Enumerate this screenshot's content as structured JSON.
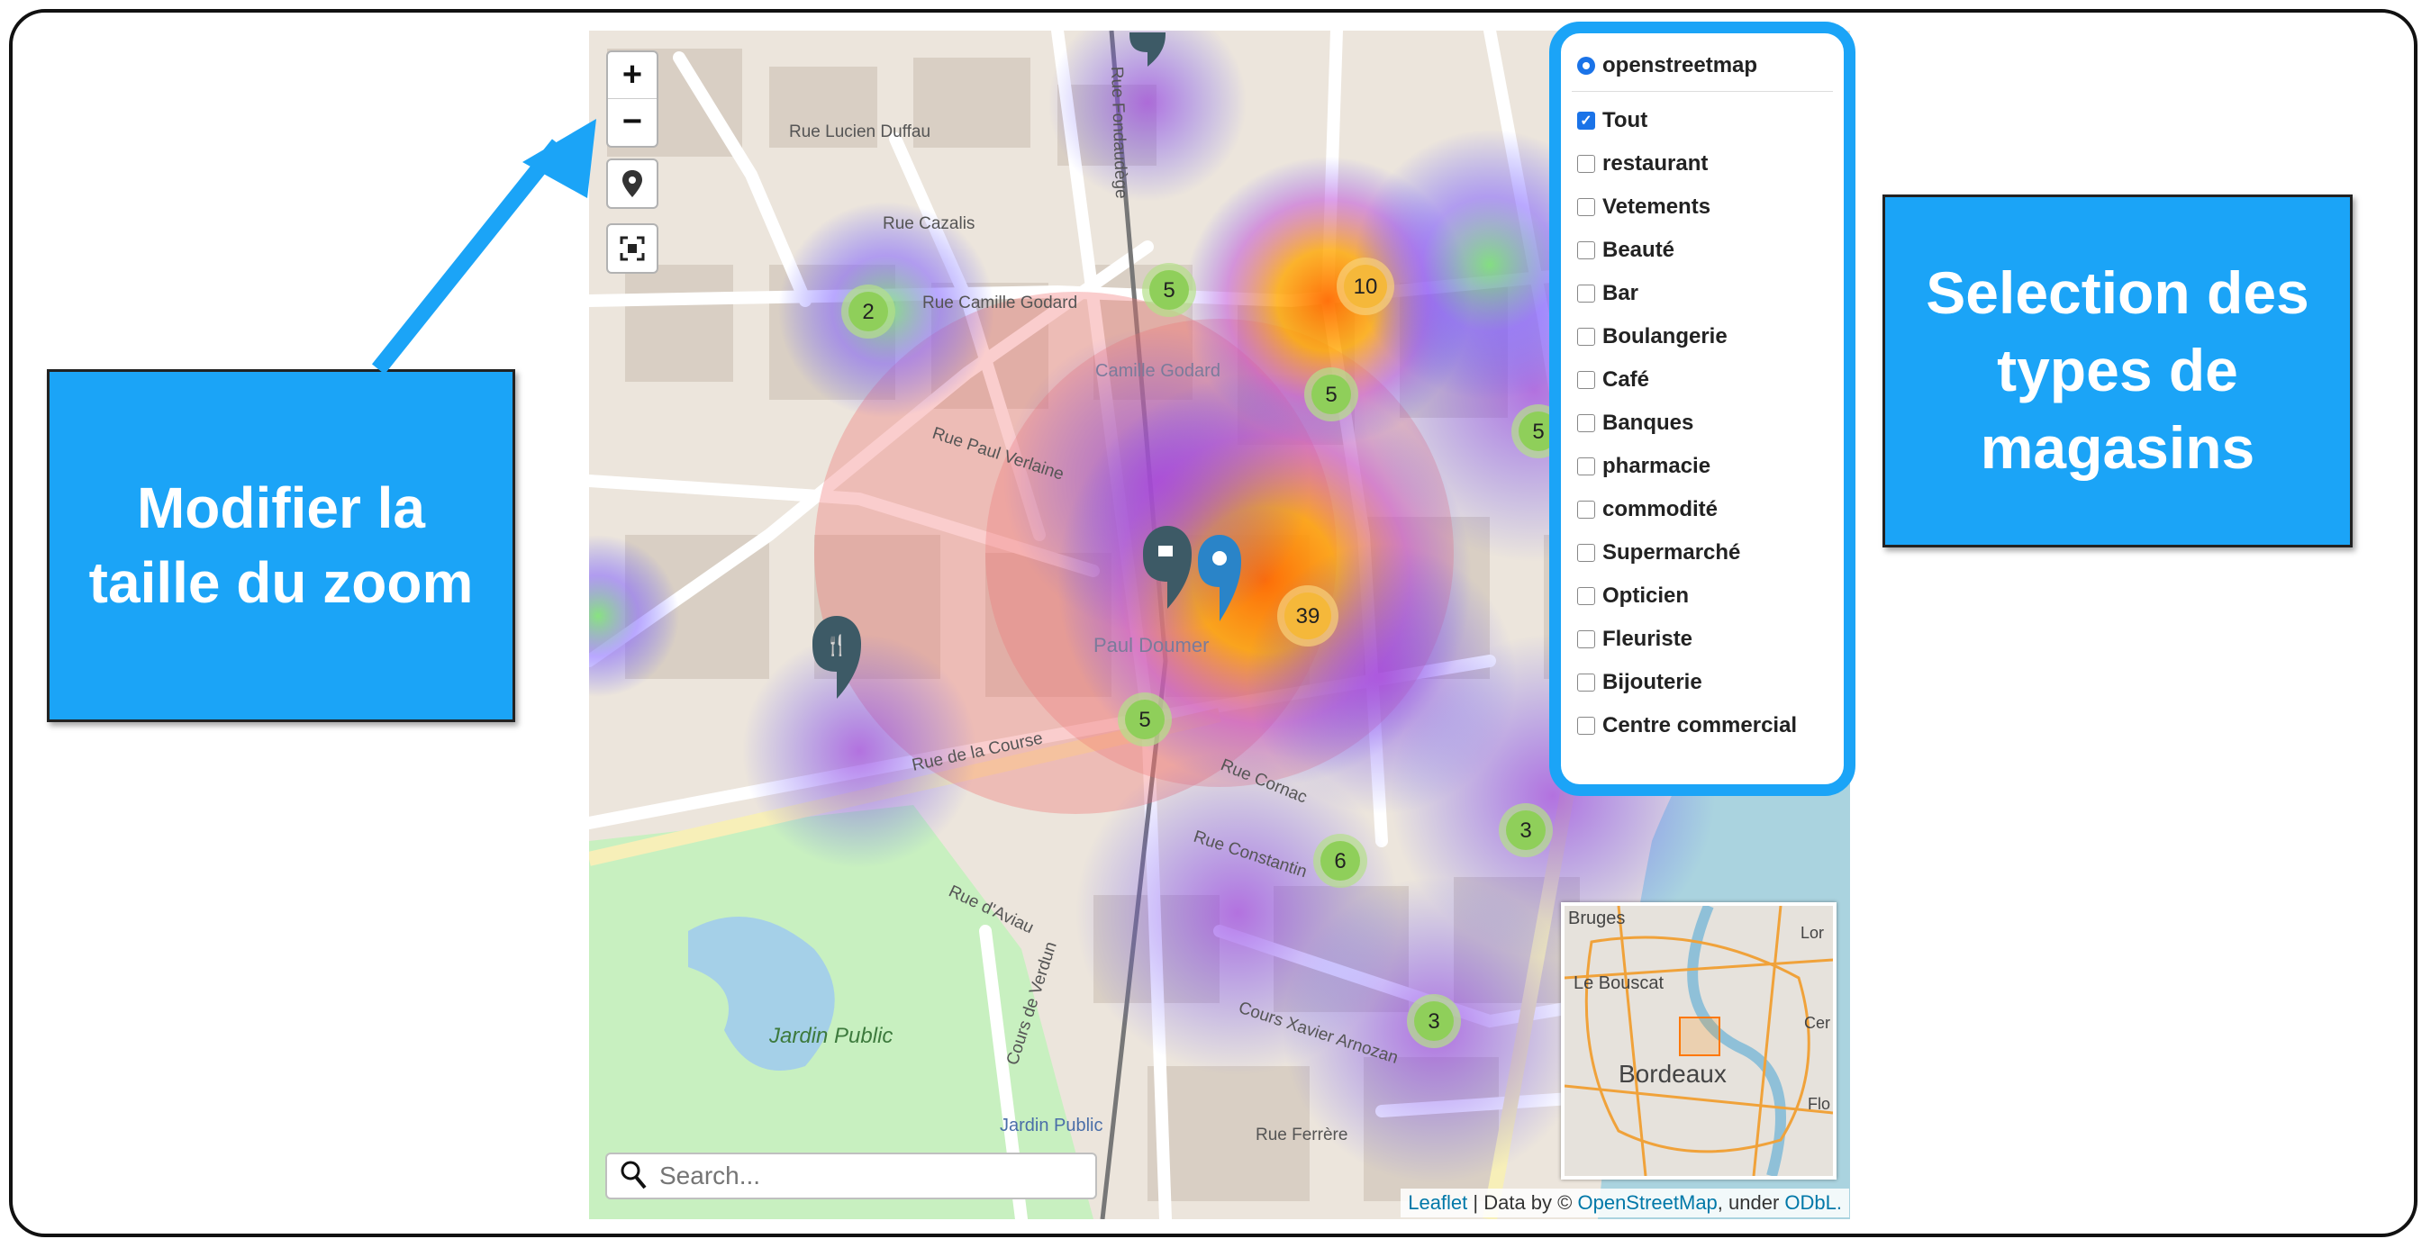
{
  "callouts": {
    "zoom": "Modifier la\ntaille du zoom",
    "types": "Selection des\ntypes de\nmagasins"
  },
  "map_controls": {
    "zoom_in": "+",
    "zoom_out": "−"
  },
  "layers": {
    "base_layer": "openstreetmap",
    "items": [
      {
        "label": "Tout",
        "checked": true
      },
      {
        "label": "restaurant",
        "checked": false
      },
      {
        "label": "Vetements",
        "checked": false
      },
      {
        "label": "Beauté",
        "checked": false
      },
      {
        "label": "Bar",
        "checked": false
      },
      {
        "label": "Boulangerie",
        "checked": false
      },
      {
        "label": "Café",
        "checked": false
      },
      {
        "label": "Banques",
        "checked": false
      },
      {
        "label": "pharmacie",
        "checked": false
      },
      {
        "label": "commodité",
        "checked": false
      },
      {
        "label": "Supermarché",
        "checked": false
      },
      {
        "label": "Opticien",
        "checked": false
      },
      {
        "label": "Fleuriste",
        "checked": false
      },
      {
        "label": "Bijouterie",
        "checked": false
      },
      {
        "label": "Centre commercial",
        "checked": false
      }
    ]
  },
  "clusters": [
    "2",
    "5",
    "10",
    "5",
    "5",
    "39",
    "5",
    "6",
    "3",
    "3"
  ],
  "map_labels": {
    "street_1": "Rue Camille Godard",
    "street_2": "Rue Lucien Duffau",
    "street_3": "Rue Cazalis",
    "street_4": "Rue Paul Verlaine",
    "street_5": "Rue Fondaudège",
    "street_6": "Rue de la Course",
    "street_7": "Rue d'Aviau",
    "street_8": "Cours de Verdun",
    "street_9": "Rue Cornac",
    "street_10": "Rue Constantin",
    "street_11": "Cours Xavier Arnozan",
    "street_12": "Rue Ferrère",
    "place_1": "Camille Godard",
    "place_2": "Paul Doumer",
    "place_3": "Jardin Public",
    "place_4": "Jardin Public"
  },
  "minimap": {
    "city": "Bordeaux",
    "labels": [
      "Bruges",
      "Le Bouscat",
      "Lor",
      "Cer",
      "Flo"
    ]
  },
  "search": {
    "placeholder": "Search..."
  },
  "attribution": {
    "leaflet": "Leaflet",
    "sep1": " | Data by © ",
    "osm": "OpenStreetMap",
    "sep2": ", under ",
    "odbl": "ODbL."
  },
  "colors": {
    "accent": "#1ba4f7",
    "cluster_fill": "#8fcf5a",
    "cluster_orange": "#f5b83a",
    "marker_dark": "#3d5a66",
    "marker_blue": "#2a84c8"
  }
}
